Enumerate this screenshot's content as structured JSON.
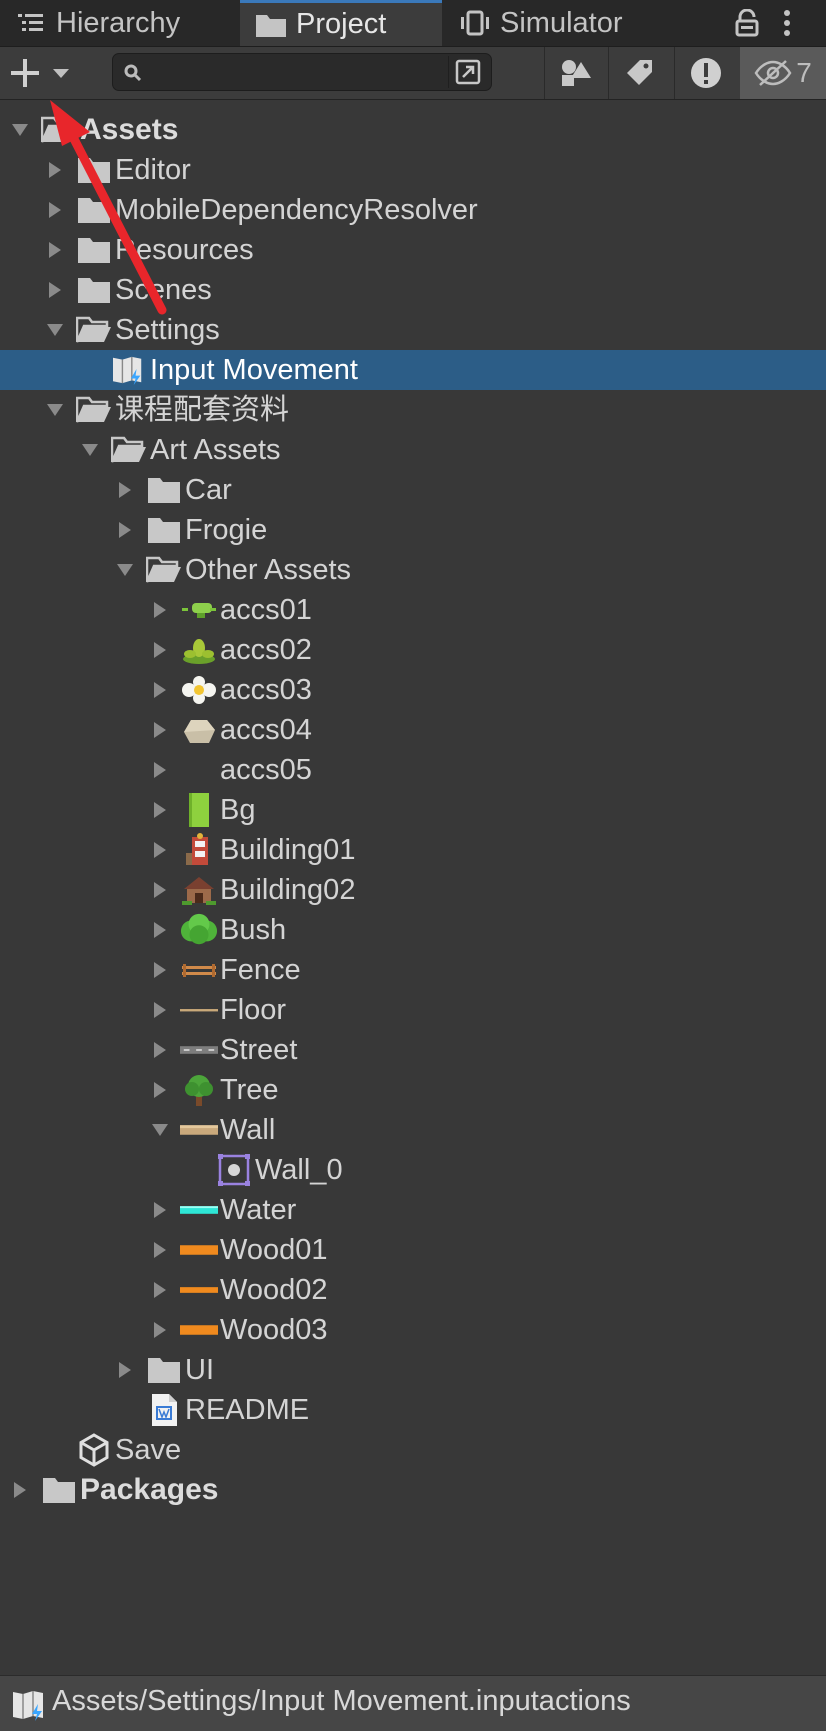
{
  "tabs": {
    "hierarchy": "Hierarchy",
    "project": "Project",
    "simulator": "Simulator"
  },
  "toolbar": {
    "search_value": "",
    "hidden_count": "7"
  },
  "tree": [
    {
      "label": "Assets",
      "depth": 0,
      "arrow": "down",
      "icon": "folder-open",
      "bold": true
    },
    {
      "label": "Editor",
      "depth": 1,
      "arrow": "right",
      "icon": "folder"
    },
    {
      "label": "MobileDependencyResolver",
      "depth": 1,
      "arrow": "right",
      "icon": "folder"
    },
    {
      "label": "Resources",
      "depth": 1,
      "arrow": "right",
      "icon": "folder"
    },
    {
      "label": "Scenes",
      "depth": 1,
      "arrow": "right",
      "icon": "folder"
    },
    {
      "label": "Settings",
      "depth": 1,
      "arrow": "down",
      "icon": "folder-open"
    },
    {
      "label": "Input Movement",
      "depth": 2,
      "arrow": "none",
      "icon": "input-actions",
      "selected": true
    },
    {
      "label": "课程配套资料",
      "depth": 1,
      "arrow": "down",
      "icon": "folder-open"
    },
    {
      "label": "Art Assets",
      "depth": 2,
      "arrow": "down",
      "icon": "folder-open"
    },
    {
      "label": "Car",
      "depth": 3,
      "arrow": "right",
      "icon": "folder"
    },
    {
      "label": "Frogie",
      "depth": 3,
      "arrow": "right",
      "icon": "folder"
    },
    {
      "label": "Other Assets",
      "depth": 3,
      "arrow": "down",
      "icon": "folder-open"
    },
    {
      "label": "accs01",
      "depth": 4,
      "arrow": "right",
      "icon": "sprite-accs01"
    },
    {
      "label": "accs02",
      "depth": 4,
      "arrow": "right",
      "icon": "sprite-accs02"
    },
    {
      "label": "accs03",
      "depth": 4,
      "arrow": "right",
      "icon": "sprite-accs03"
    },
    {
      "label": "accs04",
      "depth": 4,
      "arrow": "right",
      "icon": "sprite-accs04"
    },
    {
      "label": "accs05",
      "depth": 4,
      "arrow": "right",
      "icon": "none"
    },
    {
      "label": "Bg",
      "depth": 4,
      "arrow": "right",
      "icon": "sprite-bg"
    },
    {
      "label": "Building01",
      "depth": 4,
      "arrow": "right",
      "icon": "sprite-building01"
    },
    {
      "label": "Building02",
      "depth": 4,
      "arrow": "right",
      "icon": "sprite-building02"
    },
    {
      "label": "Bush",
      "depth": 4,
      "arrow": "right",
      "icon": "sprite-bush"
    },
    {
      "label": "Fence",
      "depth": 4,
      "arrow": "right",
      "icon": "sprite-fence"
    },
    {
      "label": "Floor",
      "depth": 4,
      "arrow": "right",
      "icon": "sprite-floor"
    },
    {
      "label": "Street",
      "depth": 4,
      "arrow": "right",
      "icon": "sprite-street"
    },
    {
      "label": "Tree",
      "depth": 4,
      "arrow": "right",
      "icon": "sprite-tree"
    },
    {
      "label": "Wall",
      "depth": 4,
      "arrow": "down",
      "icon": "sprite-wall"
    },
    {
      "label": "Wall_0",
      "depth": 5,
      "arrow": "none",
      "icon": "sprite-frame"
    },
    {
      "label": "Water",
      "depth": 4,
      "arrow": "right",
      "icon": "sprite-water"
    },
    {
      "label": "Wood01",
      "depth": 4,
      "arrow": "right",
      "icon": "sprite-wood"
    },
    {
      "label": "Wood02",
      "depth": 4,
      "arrow": "right",
      "icon": "sprite-wood-thin"
    },
    {
      "label": "Wood03",
      "depth": 4,
      "arrow": "right",
      "icon": "sprite-wood"
    },
    {
      "label": "UI",
      "depth": 3,
      "arrow": "right",
      "icon": "folder"
    },
    {
      "label": "README",
      "depth": 3,
      "arrow": "none",
      "icon": "document"
    },
    {
      "label": "Save",
      "depth": 1,
      "arrow": "none",
      "icon": "unity-package"
    },
    {
      "label": "Packages",
      "depth": 0,
      "arrow": "right",
      "icon": "folder",
      "bold": true
    }
  ],
  "status": {
    "path": "Assets/Settings/Input Movement.inputactions"
  },
  "colors": {
    "background": "#383838",
    "selection": "#2c5d87",
    "tab_accent": "#3a79bb",
    "annotation_arrow": "#e8262b"
  }
}
